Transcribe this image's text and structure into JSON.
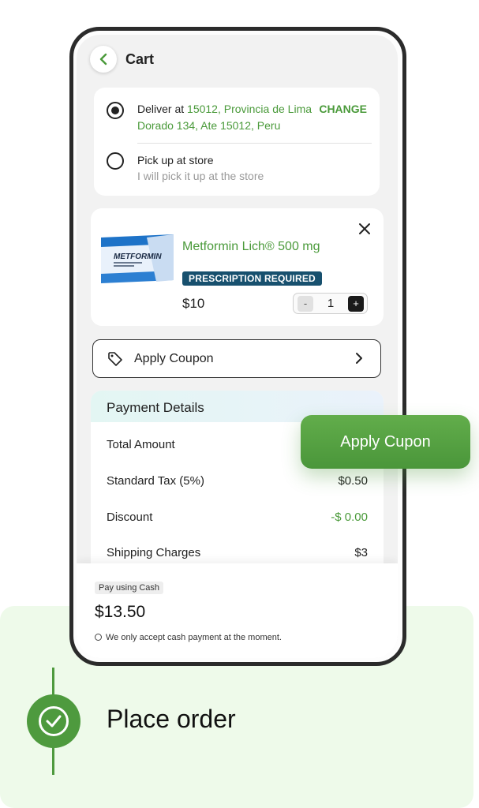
{
  "header": {
    "title": "Cart"
  },
  "delivery": {
    "deliver_prefix": "Deliver at",
    "address_line1": "15012, Provincia de Lima",
    "address_line2": "Dorado 134, Ate 15012, Peru",
    "change_label": "CHANGE",
    "pickup_title": "Pick up at store",
    "pickup_subtitle": "I will pick it up at the store",
    "selected_option": "deliver"
  },
  "product": {
    "box_text": "METFORMIN",
    "name": "Metformin Lich® 500 mg",
    "badge": "PRESCRIPTION REQUIRED",
    "price": "$10",
    "quantity": "1",
    "minus_label": "-",
    "plus_label": "+"
  },
  "coupon": {
    "label": "Apply Coupon"
  },
  "payment": {
    "title": "Payment Details",
    "rows": [
      {
        "label": "Total Amount",
        "value": ""
      },
      {
        "label": "Standard Tax (5%)",
        "value": "$0.50"
      },
      {
        "label": "Discount",
        "value": "-$ 0.00"
      },
      {
        "label": "Shipping Charges",
        "value": "$3"
      }
    ]
  },
  "footer": {
    "pay_badge": "Pay using Cash",
    "total": "$13.50",
    "note": "We only accept cash payment at the moment."
  },
  "floating_button": {
    "label": "Apply Cupon"
  },
  "step": {
    "label": "Place order",
    "status": "completed"
  },
  "colors": {
    "brand_green": "#4a9a3a",
    "badge_blue": "#17506e",
    "panel_bg": "#eefaea"
  }
}
